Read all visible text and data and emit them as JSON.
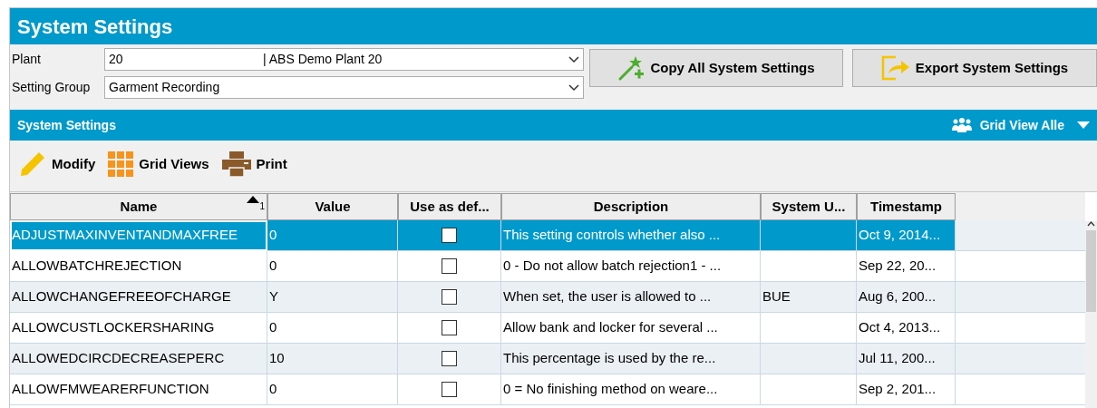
{
  "window": {
    "title": "System Settings"
  },
  "filters": [
    {
      "label": "Plant",
      "value": "20",
      "detail": "| ABS Demo Plant 20"
    },
    {
      "label": "Setting Group",
      "value": "Garment Recording"
    }
  ],
  "actions": [
    {
      "kind": "copy",
      "label": "Copy All System Settings"
    },
    {
      "kind": "export",
      "label": "Export System Settings"
    }
  ],
  "section": {
    "title": "System Settings",
    "grid_view": "Grid View Alle"
  },
  "toolbar": [
    {
      "kind": "modify",
      "label": "Modify"
    },
    {
      "kind": "grid",
      "label": "Grid Views"
    },
    {
      "kind": "print",
      "label": "Print"
    }
  ],
  "table": {
    "columns": [
      {
        "label": "Name",
        "sort": "1"
      },
      {
        "label": "Value"
      },
      {
        "label": "Use as def..."
      },
      {
        "label": "Description"
      },
      {
        "label": "System U..."
      },
      {
        "label": "Timestamp"
      }
    ],
    "rows": [
      {
        "selected": true,
        "name": "ADJUSTMAXINVENTANDMAXFREE",
        "value": "0",
        "use_default": false,
        "description": "This setting controls whether also ...",
        "system_user": "",
        "timestamp": "Oct 9, 2014..."
      },
      {
        "selected": false,
        "name": "ALLOWBATCHREJECTION",
        "value": "0",
        "use_default": false,
        "description": "0  - Do not allow batch rejection1 - ...",
        "system_user": "",
        "timestamp": "Sep 22, 20..."
      },
      {
        "selected": false,
        "name": "ALLOWCHANGEFREEOFCHARGE",
        "value": "Y",
        "use_default": false,
        "description": "When set, the user is allowed to ...",
        "system_user": "BUE",
        "timestamp": "Aug 6, 200..."
      },
      {
        "selected": false,
        "name": "ALLOWCUSTLOCKERSHARING",
        "value": "0",
        "use_default": false,
        "description": "Allow  bank and locker for several ...",
        "system_user": "",
        "timestamp": "Oct 4, 2013..."
      },
      {
        "selected": false,
        "name": "ALLOWEDCIRCDECREASEPERC",
        "value": "10",
        "use_default": false,
        "description": "This percentage is used by the re...",
        "system_user": "",
        "timestamp": "Jul 11, 200..."
      },
      {
        "selected": false,
        "name": "ALLOWFMWEARERFUNCTION",
        "value": "0",
        "use_default": false,
        "description": "0 = No finishing method on weare...",
        "system_user": "",
        "timestamp": "Sep 2, 201..."
      }
    ]
  }
}
